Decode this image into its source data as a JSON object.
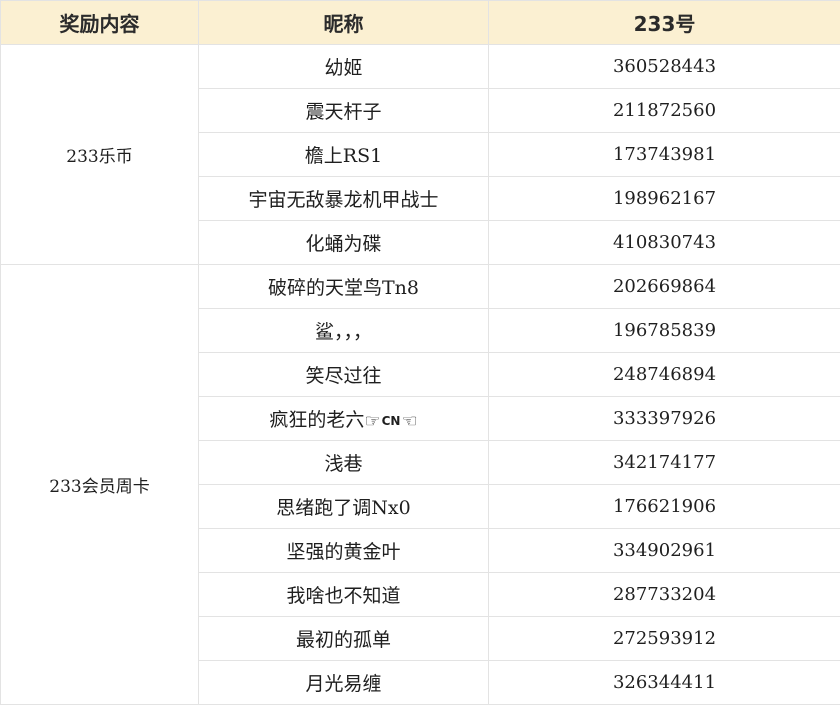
{
  "header": {
    "reward": "奖励内容",
    "nickname": "昵称",
    "uid": "233号"
  },
  "groups": [
    {
      "reward": "233乐币",
      "rows": [
        {
          "nickname": "幼姬",
          "uid": "360528443"
        },
        {
          "nickname": "震天杆子",
          "uid": "211872560"
        },
        {
          "nickname": "檐上RS1",
          "uid": "173743981"
        },
        {
          "nickname": "宇宙无敌暴龙机甲战士",
          "uid": "198962167"
        },
        {
          "nickname": "化蛹为碟",
          "uid": "410830743"
        }
      ]
    },
    {
      "reward": "233会员周卡",
      "rows": [
        {
          "nickname": "破碎的天堂鸟Tn8",
          "uid": "202669864"
        },
        {
          "nickname": "鲨，，，",
          "uid": "196785839"
        },
        {
          "nickname": "笑尽过往",
          "uid": "248746894"
        },
        {
          "nickname": "疯狂的老六",
          "nickname_suffix": "CN",
          "uid": "333397926"
        },
        {
          "nickname": "浅巷",
          "uid": "342174177"
        },
        {
          "nickname": "思绪跑了调Nx0",
          "uid": "176621906"
        },
        {
          "nickname": "坚强的黄金叶",
          "uid": "334902961"
        },
        {
          "nickname": "我啥也不知道",
          "uid": "287733204"
        },
        {
          "nickname": "最初的孤单",
          "uid": "272593912"
        },
        {
          "nickname": "月光易缠",
          "uid": "326344411"
        }
      ]
    }
  ],
  "icons": {
    "left": "pointing-hand-right-icon",
    "right": "pointing-hand-left-icon"
  }
}
